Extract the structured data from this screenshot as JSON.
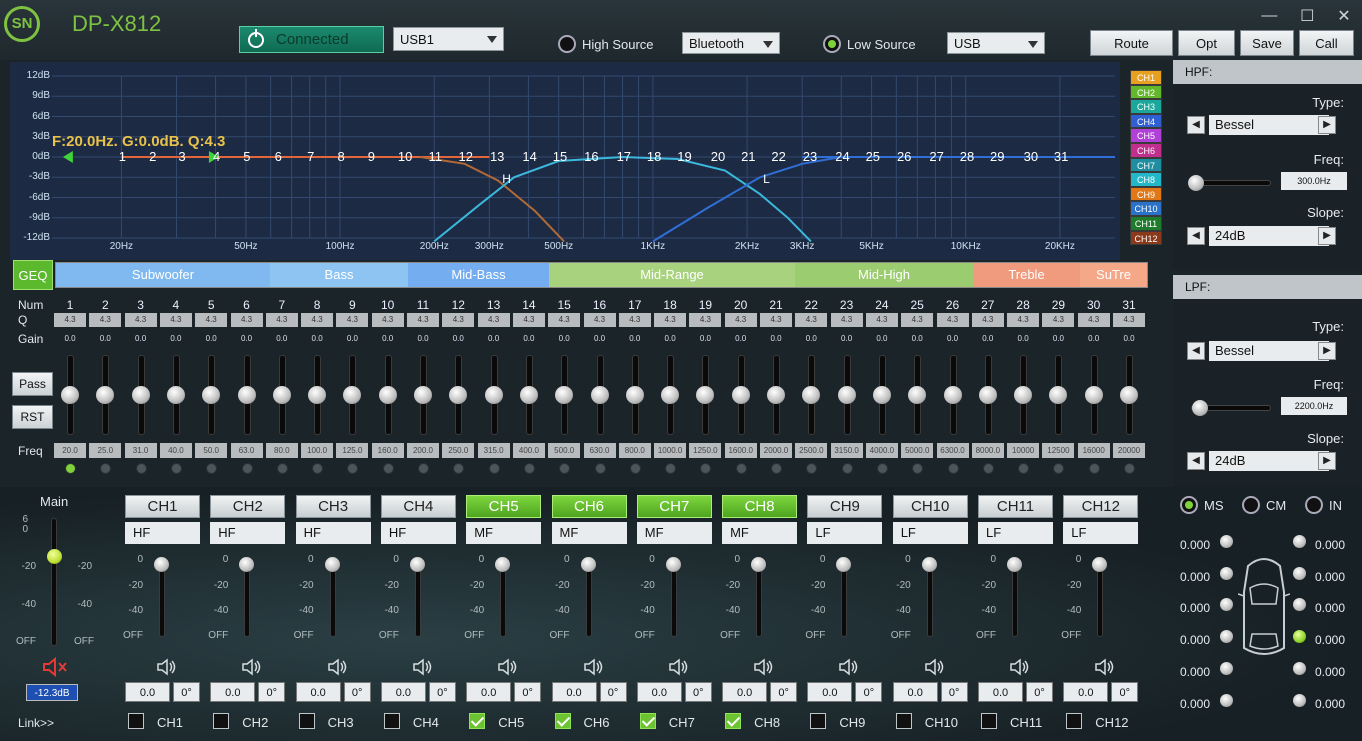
{
  "app": {
    "logo_text": "SN",
    "title": "DP-X812",
    "minimize": "—",
    "maximize": "☐",
    "close": "✕"
  },
  "toolbar": {
    "connected_label": "Connected",
    "usb_select": "USB1",
    "high_source_label": "High Source",
    "high_source_value": "Bluetooth",
    "low_source_label": "Low Source",
    "low_source_value": "USB",
    "route": "Route",
    "opt": "Opt",
    "save": "Save",
    "call": "Call"
  },
  "graph": {
    "readout": "F:20.0Hz. G:0.0dB. Q:4.3",
    "y_ticks": [
      "12dB",
      "9dB",
      "6dB",
      "3dB",
      "0dB",
      "-3dB",
      "-6dB",
      "-9dB",
      "-12dB"
    ],
    "x_ticks": [
      "20Hz",
      "50Hz",
      "100Hz",
      "200Hz",
      "300Hz",
      "500Hz",
      "1KHz",
      "2KHz",
      "3KHz",
      "5KHz",
      "10KHz",
      "20KHz"
    ],
    "band_numbers": [
      "1",
      "2",
      "3",
      "4",
      "5",
      "6",
      "7",
      "8",
      "9",
      "10",
      "11",
      "12",
      "13",
      "14",
      "15",
      "16",
      "17",
      "18",
      "19",
      "20",
      "21",
      "22",
      "23",
      "24",
      "25",
      "26",
      "27",
      "28",
      "29",
      "30",
      "31"
    ],
    "marker_h": "H",
    "marker_l": "L"
  },
  "channel_legend": [
    {
      "label": "CH1",
      "color": "#e8a020"
    },
    {
      "label": "CH2",
      "color": "#62b82a"
    },
    {
      "label": "CH3",
      "color": "#1aa89c"
    },
    {
      "label": "CH4",
      "color": "#2f5fd0"
    },
    {
      "label": "CH5",
      "color": "#b040d8"
    },
    {
      "label": "CH6",
      "color": "#c02e8e"
    },
    {
      "label": "CH7",
      "color": "#1e8ea0"
    },
    {
      "label": "CH8",
      "color": "#22b8c8"
    },
    {
      "label": "CH9",
      "color": "#e07818"
    },
    {
      "label": "CH10",
      "color": "#2a72c8"
    },
    {
      "label": "CH11",
      "color": "#1e7c2c"
    },
    {
      "label": "CH12",
      "color": "#8a3a1a"
    }
  ],
  "hpf": {
    "title": "HPF:",
    "type_label": "Type:",
    "type_value": "Bessel",
    "freq_label": "Freq:",
    "freq_value": "300.0Hz",
    "slope_label": "Slope:",
    "slope_value": "24dB",
    "slider_level": 0.0
  },
  "lpf": {
    "title": "LPF:",
    "type_label": "Type:",
    "type_value": "Bessel",
    "freq_label": "Freq:",
    "freq_value": "2200.0Hz",
    "slope_label": "Slope:",
    "slope_value": "24dB",
    "slider_level": 0.05
  },
  "geq": {
    "button": "GEQ",
    "pass": "Pass",
    "rst": "RST",
    "num_label": "Num",
    "q_label": "Q",
    "gain_label": "Gain",
    "freq_label": "Freq",
    "bands": [
      {
        "label": "Subwoofer",
        "color": "#7fb9ef"
      },
      {
        "label": "Bass",
        "color": "#8ec4f2"
      },
      {
        "label": "Mid-Bass",
        "color": "#74aef0"
      },
      {
        "label": "Mid-Range",
        "color": "#a8d27e"
      },
      {
        "label": "Mid-High",
        "color": "#9ccc70"
      },
      {
        "label": "Treble",
        "color": "#f09a7e"
      },
      {
        "label": "SuTre",
        "color": "#f5a888"
      }
    ],
    "nums": [
      "1",
      "2",
      "3",
      "4",
      "5",
      "6",
      "7",
      "8",
      "9",
      "10",
      "11",
      "12",
      "13",
      "14",
      "15",
      "16",
      "17",
      "18",
      "19",
      "20",
      "21",
      "22",
      "23",
      "24",
      "25",
      "26",
      "27",
      "28",
      "29",
      "30",
      "31"
    ],
    "q": "4.3",
    "gain": "0.0",
    "freqs": [
      "20.0",
      "25.0",
      "31.0",
      "40.0",
      "50.0",
      "63.0",
      "80.0",
      "100.0",
      "125.0",
      "160.0",
      "200.0",
      "250.0",
      "315.0",
      "400.0",
      "500.0",
      "630.0",
      "800.0",
      "1000.0",
      "1250.0",
      "1600.0",
      "2000.0",
      "2500.0",
      "3150.0",
      "4000.0",
      "5000.0",
      "6300.0",
      "8000.0",
      "10000",
      "12500",
      "16000",
      "20000"
    ],
    "active_index": 0
  },
  "main": {
    "label": "Main",
    "scale_left": [
      "6",
      "0",
      "-20",
      "-40",
      "OFF"
    ],
    "scale_right": [
      "-20",
      "-40",
      "OFF"
    ],
    "value": "-12.3dB",
    "link": "Link>>"
  },
  "channels": [
    {
      "name": "CH1",
      "on": false,
      "route": "HF",
      "delay": "0.0",
      "phase": "0°"
    },
    {
      "name": "CH2",
      "on": false,
      "route": "HF",
      "delay": "0.0",
      "phase": "0°"
    },
    {
      "name": "CH3",
      "on": false,
      "route": "HF",
      "delay": "0.0",
      "phase": "0°"
    },
    {
      "name": "CH4",
      "on": false,
      "route": "HF",
      "delay": "0.0",
      "phase": "0°"
    },
    {
      "name": "CH5",
      "on": true,
      "route": "MF",
      "delay": "0.0",
      "phase": "0°"
    },
    {
      "name": "CH6",
      "on": true,
      "route": "MF",
      "delay": "0.0",
      "phase": "0°"
    },
    {
      "name": "CH7",
      "on": true,
      "route": "MF",
      "delay": "0.0",
      "phase": "0°"
    },
    {
      "name": "CH8",
      "on": true,
      "route": "MF",
      "delay": "0.0",
      "phase": "0°"
    },
    {
      "name": "CH9",
      "on": false,
      "route": "LF",
      "delay": "0.0",
      "phase": "0°"
    },
    {
      "name": "CH10",
      "on": false,
      "route": "LF",
      "delay": "0.0",
      "phase": "0°"
    },
    {
      "name": "CH11",
      "on": false,
      "route": "LF",
      "delay": "0.0",
      "phase": "0°"
    },
    {
      "name": "CH12",
      "on": false,
      "route": "LF",
      "delay": "0.0",
      "phase": "0°"
    }
  ],
  "channel_scale": [
    "0",
    "-20",
    "-40",
    "OFF"
  ],
  "delay_mode": {
    "ms": "MS",
    "cm": "CM",
    "in": "IN",
    "selected": "MS"
  },
  "delay_values_left": [
    "0.000",
    "0.000",
    "0.000",
    "0.000",
    "0.000",
    "0.000"
  ],
  "delay_values_right": [
    "0.000",
    "0.000",
    "0.000",
    "0.000",
    "0.000",
    "0.000"
  ],
  "delay_active_right_index": 3
}
